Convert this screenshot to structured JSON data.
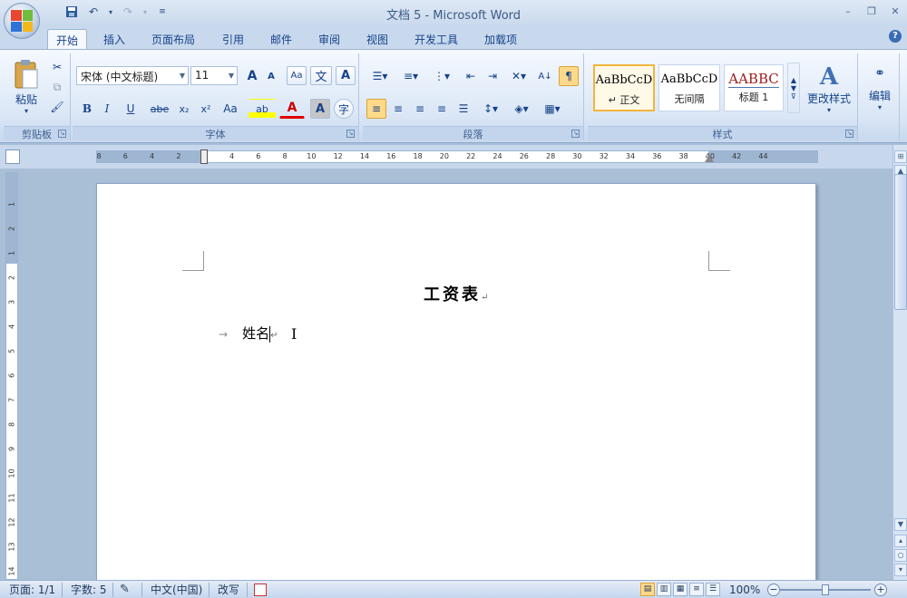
{
  "title_bar": {
    "title": "文档 5 - Microsoft Word",
    "qat": {
      "save_icon": "floppy-save-icon",
      "undo_icon": "undo-icon",
      "redo_icon": "redo-icon",
      "customize_icon": "qat-dropdown-icon"
    },
    "window_controls": {
      "minimize": "–",
      "restore": "❐",
      "close": "✕"
    }
  },
  "tabs": [
    {
      "label": "开始",
      "active": true
    },
    {
      "label": "插入"
    },
    {
      "label": "页面布局"
    },
    {
      "label": "引用"
    },
    {
      "label": "邮件"
    },
    {
      "label": "审阅"
    },
    {
      "label": "视图"
    },
    {
      "label": "开发工具"
    },
    {
      "label": "加载项"
    }
  ],
  "ribbon": {
    "clipboard": {
      "label": "剪贴板",
      "paste": "粘贴"
    },
    "font": {
      "label": "字体",
      "font_name": "宋体 (中文标题)",
      "font_size": "11",
      "bold": "B",
      "italic": "I",
      "underline": "U",
      "strike": "abe",
      "sub": "x₂",
      "sup": "x²",
      "case": "Aa",
      "grow": "A",
      "shrink": "A",
      "highlight": "ab",
      "font_color": "A",
      "char_shade": "A",
      "enclose": "字",
      "phonetic": "文",
      "border": "A"
    },
    "paragraph": {
      "label": "段落"
    },
    "styles": {
      "label": "样式",
      "items": [
        {
          "sample": "AaBbCcD",
          "name": "↵ 正文",
          "selected": true
        },
        {
          "sample": "AaBbCcD",
          "name": "无间隔"
        },
        {
          "sample": "AABBC",
          "name": "标题 1"
        }
      ],
      "change_styles": "更改样式"
    },
    "editing": {
      "label": "编辑"
    }
  },
  "ruler": {
    "ticks": [
      "8",
      "6",
      "4",
      "2",
      "2",
      "4",
      "6",
      "8",
      "10",
      "12",
      "14",
      "16",
      "18",
      "20",
      "22",
      "24",
      "26",
      "28",
      "30",
      "32",
      "34",
      "36",
      "38",
      "40",
      "42",
      "44"
    ]
  },
  "document": {
    "title": "工资表",
    "title_mark": "↵",
    "line1_tab": "→",
    "line1_text": "姓名",
    "line1_mark": "↵",
    "ibeam": "I"
  },
  "status_bar": {
    "page": "页面: 1/1",
    "words": "字数: 5",
    "language": "中文(中国)",
    "mode": "改写",
    "zoom": "100%",
    "zoom_minus": "−",
    "zoom_plus": "+"
  }
}
